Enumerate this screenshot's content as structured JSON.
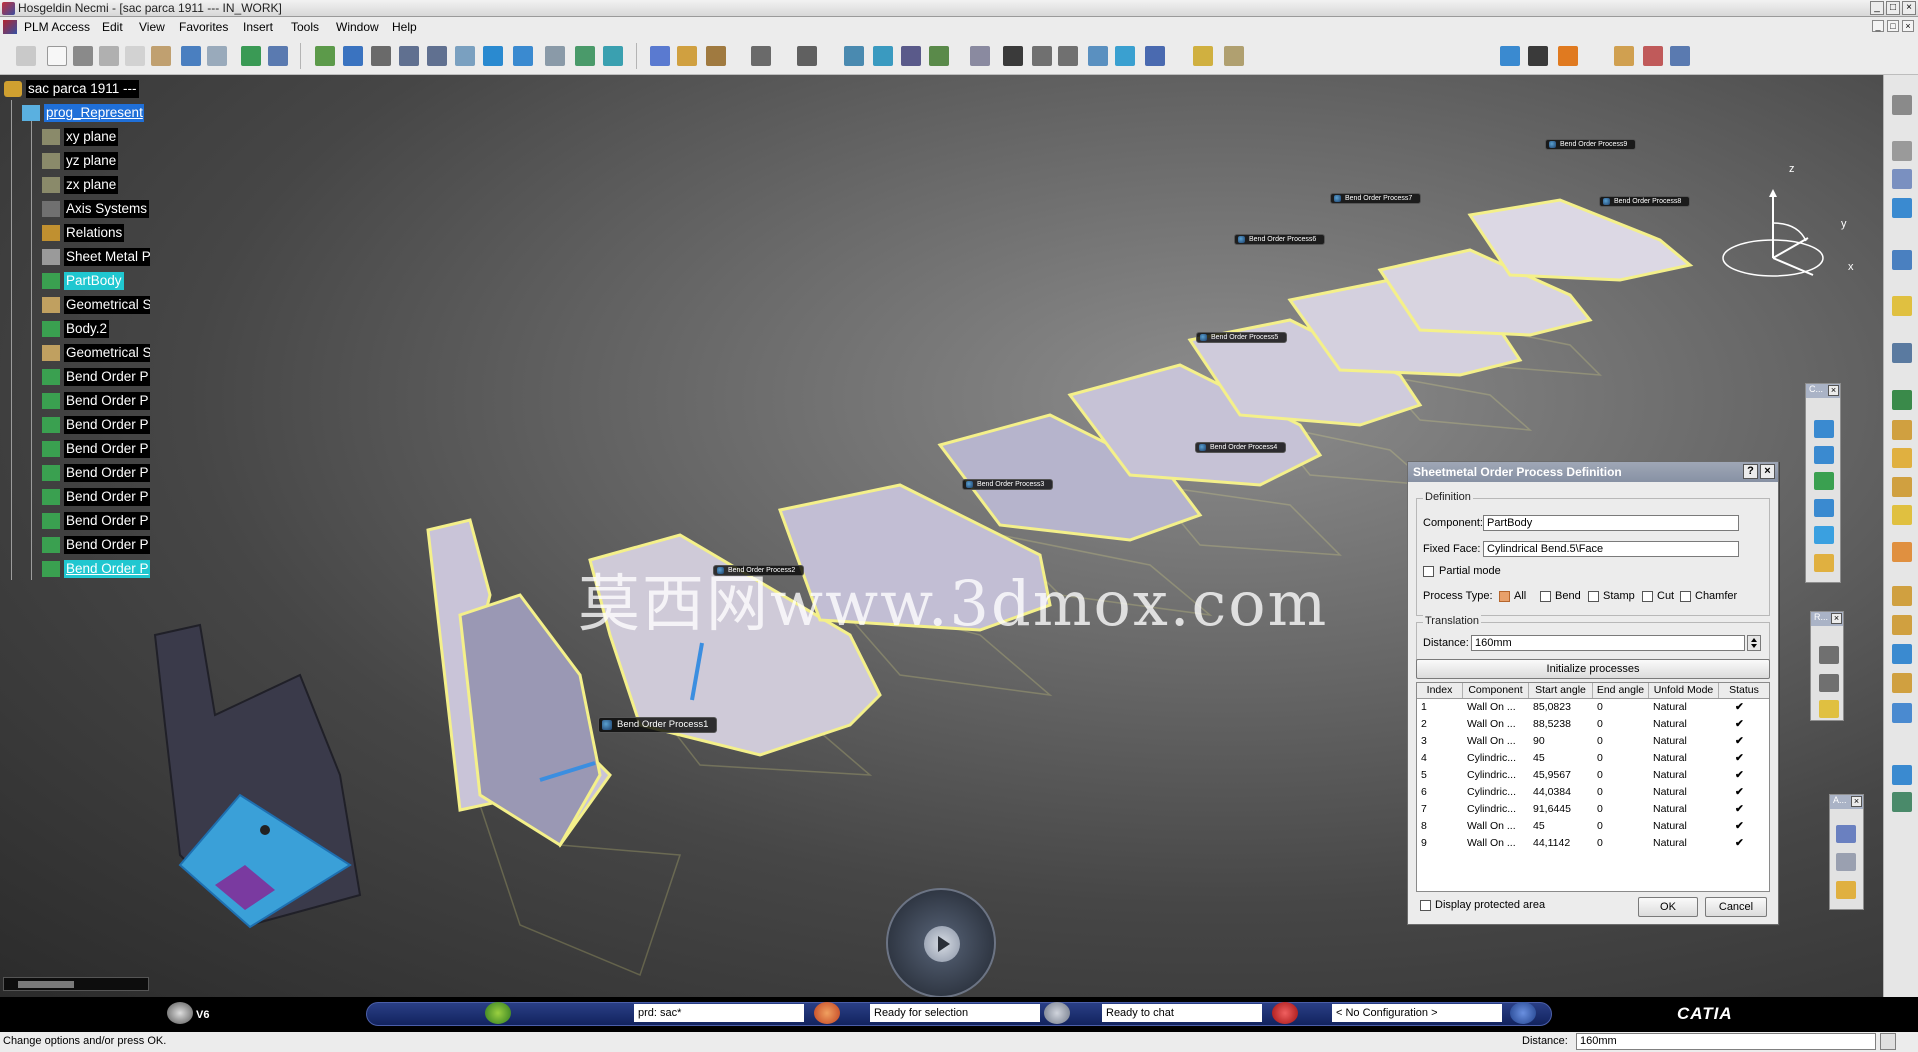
{
  "window": {
    "title": "Hosgeldin Necmi - [sac parca 1911 --- IN_WORK]",
    "controls": [
      "_",
      "□",
      "×"
    ]
  },
  "menubar": {
    "items": [
      "PLM Access",
      "Edit",
      "View",
      "Favorites",
      "Insert",
      "Tools",
      "Window",
      "Help"
    ],
    "mdi_controls": [
      "_",
      "□",
      "×"
    ]
  },
  "tree": {
    "root": "sac parca 1911 ---",
    "items": [
      {
        "label": "prog_Represent"
      },
      {
        "label": "xy plane"
      },
      {
        "label": "yz plane"
      },
      {
        "label": "zx plane"
      },
      {
        "label": "Axis Systems"
      },
      {
        "label": "Relations"
      },
      {
        "label": "Sheet Metal P"
      },
      {
        "label": "PartBody"
      },
      {
        "label": "Geometrical S"
      },
      {
        "label": "Body.2"
      },
      {
        "label": "Geometrical S"
      },
      {
        "label": "Bend Order P"
      },
      {
        "label": "Bend Order P"
      },
      {
        "label": "Bend Order P"
      },
      {
        "label": "Bend Order P"
      },
      {
        "label": "Bend Order P"
      },
      {
        "label": "Bend Order P"
      },
      {
        "label": "Bend Order P"
      },
      {
        "label": "Bend Order P"
      },
      {
        "label": "Bend Order P"
      }
    ]
  },
  "compass": {
    "x": "x",
    "y": "y",
    "z": "z"
  },
  "watermark": "莫西网www.3dmox.com",
  "callouts": {
    "p1": "Bend Order Process1",
    "p2": "Bend Order Process2",
    "p3": "Bend Order Process3",
    "p4": "Bend Order Process4",
    "p5": "Bend Order Process5",
    "p6": "Bend Order Process6",
    "p7": "Bend Order Process7",
    "p8": "Bend Order Process8",
    "p9": "Bend Order Process9"
  },
  "dialog": {
    "title": "Sheetmetal Order Process Definition",
    "help_btn": "?",
    "close_btn": "×",
    "definition_label": "Definition",
    "component_label": "Component:",
    "component_value": "PartBody",
    "fixed_face_label": "Fixed Face:",
    "fixed_face_value": "Cylindrical Bend.5\\Face",
    "partial_mode_label": "Partial mode",
    "process_type_label": "Process Type:",
    "types": {
      "all": "All",
      "bend": "Bend",
      "stamp": "Stamp",
      "cut": "Cut",
      "chamfer": "Chamfer"
    },
    "translation_label": "Translation",
    "distance_label": "Distance:",
    "distance_value": "160mm",
    "init_button": "Initialize processes",
    "columns": [
      "Index",
      "Component",
      "Start angle",
      "End angle",
      "Unfold Mode",
      "Status"
    ],
    "rows": [
      {
        "index": "1",
        "component": "Wall On ...",
        "start": "85,0823",
        "end": "0",
        "mode": "Natural",
        "status": "✔"
      },
      {
        "index": "2",
        "component": "Wall On ...",
        "start": "88,5238",
        "end": "0",
        "mode": "Natural",
        "status": "✔"
      },
      {
        "index": "3",
        "component": "Wall On ...",
        "start": "90",
        "end": "0",
        "mode": "Natural",
        "status": "✔"
      },
      {
        "index": "4",
        "component": "Cylindric...",
        "start": "45",
        "end": "0",
        "mode": "Natural",
        "status": "✔"
      },
      {
        "index": "5",
        "component": "Cylindric...",
        "start": "45,9567",
        "end": "0",
        "mode": "Natural",
        "status": "✔"
      },
      {
        "index": "6",
        "component": "Cylindric...",
        "start": "44,0384",
        "end": "0",
        "mode": "Natural",
        "status": "✔"
      },
      {
        "index": "7",
        "component": "Cylindric...",
        "start": "91,6445",
        "end": "0",
        "mode": "Natural",
        "status": "✔"
      },
      {
        "index": "8",
        "component": "Wall On ...",
        "start": "45",
        "end": "0",
        "mode": "Natural",
        "status": "✔"
      },
      {
        "index": "9",
        "component": "Wall On ...",
        "start": "44,1142",
        "end": "0",
        "mode": "Natural",
        "status": "✔"
      }
    ],
    "display_protected_label": "Display protected area",
    "ok_label": "OK",
    "cancel_label": "Cancel"
  },
  "floating_toolbars": {
    "t1": "C...",
    "t2": "R...",
    "t3": "A..."
  },
  "statusbar": {
    "v6": "V6",
    "field1": "prd: sac*",
    "field2": "Ready for selection",
    "field3": "Ready to chat",
    "field4": "< No Configuration >",
    "brand": "CATIA",
    "message": "Change options and/or press OK.",
    "distance_label": "Distance:",
    "distance_value": "160mm"
  },
  "colors": {
    "part_yellow": "#f4f08a",
    "selected_blue": "#1f6fd8",
    "highlight_cyan": "#20c7d0",
    "status_green": "#1bbb1b",
    "dialog_title": "#8f99ab"
  }
}
